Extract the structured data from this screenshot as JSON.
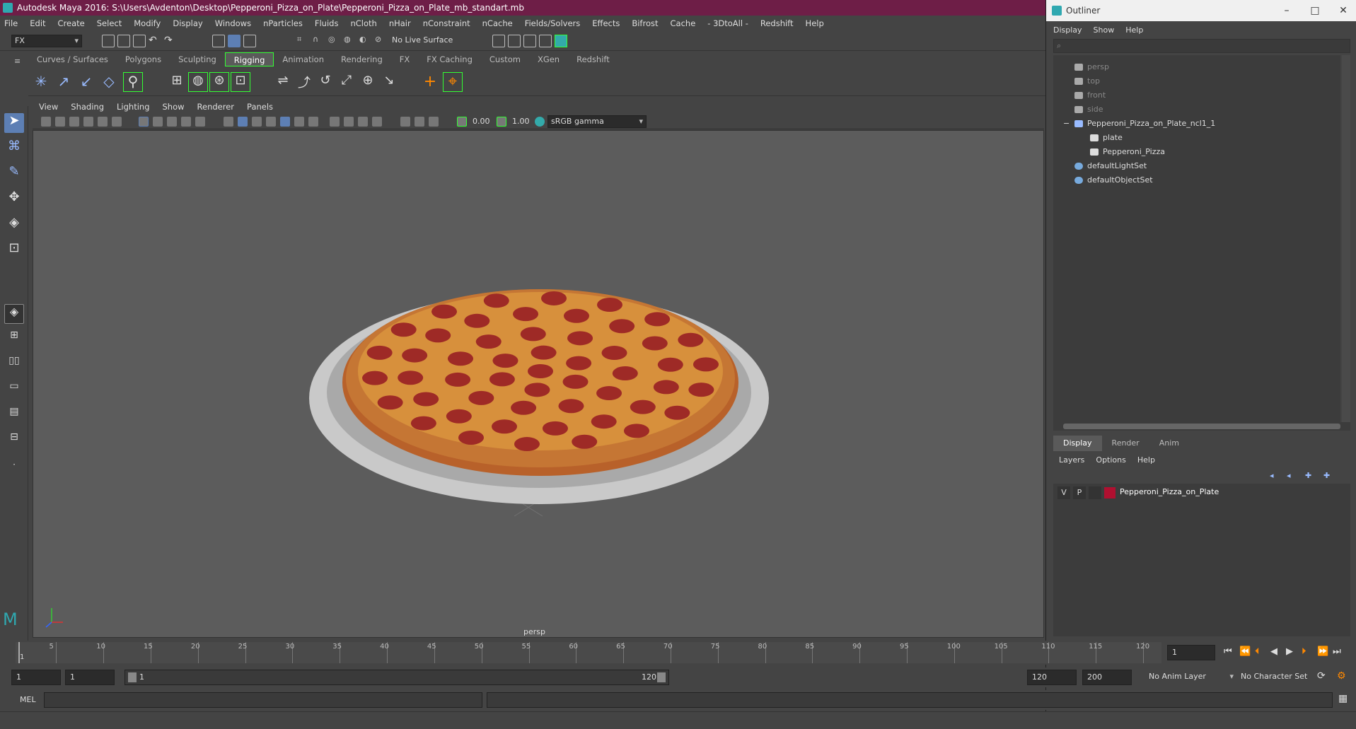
{
  "window": {
    "title": "Autodesk Maya 2016: S:\\Users\\Avdenton\\Desktop\\Pepperoni_Pizza_on_Plate\\Pepperoni_Pizza_on_Plate_mb_standart.mb"
  },
  "menubar": [
    "File",
    "Edit",
    "Create",
    "Select",
    "Modify",
    "Display",
    "Windows",
    "nParticles",
    "Fluids",
    "nCloth",
    "nHair",
    "nConstraint",
    "nCache",
    "Fields/Solvers",
    "Effects",
    "Bifrost",
    "Cache",
    "- 3DtoAll -",
    "Redshift",
    "Help"
  ],
  "statusline": {
    "mode": "FX",
    "live_surface": "No Live Surface"
  },
  "shelf": {
    "tabs": [
      "Curves / Surfaces",
      "Polygons",
      "Sculpting",
      "Rigging",
      "Animation",
      "Rendering",
      "FX",
      "FX Caching",
      "Custom",
      "XGen",
      "Redshift"
    ],
    "active_tab": "Rigging"
  },
  "viewport": {
    "menu": [
      "View",
      "Shading",
      "Lighting",
      "Show",
      "Renderer",
      "Panels"
    ],
    "exposure": "0.00",
    "gamma": "1.00",
    "colorspace": "sRGB gamma",
    "camera_label": "persp",
    "colors": {
      "bg": "#5c5c5c",
      "plate": "#c9c9c9",
      "crust": "#b8612a",
      "cheese": "#d7903c",
      "pepperoni": "#9e2a26"
    }
  },
  "outliner": {
    "title": "Outliner",
    "menu": [
      "Display",
      "Show",
      "Help"
    ],
    "nodes": [
      {
        "label": "persp",
        "icon": "camera-icon",
        "level": 0,
        "dim": true
      },
      {
        "label": "top",
        "icon": "camera-icon",
        "level": 0,
        "dim": true
      },
      {
        "label": "front",
        "icon": "camera-icon",
        "level": 0,
        "dim": true
      },
      {
        "label": "side",
        "icon": "camera-icon",
        "level": 0,
        "dim": true
      },
      {
        "label": "Pepperoni_Pizza_on_Plate_ncl1_1",
        "icon": "joint-icon",
        "level": 0,
        "dim": false,
        "expand": "−"
      },
      {
        "label": "plate",
        "icon": "mesh-icon",
        "level": 1,
        "dim": false
      },
      {
        "label": "Pepperoni_Pizza",
        "icon": "mesh-icon",
        "level": 1,
        "dim": false
      },
      {
        "label": "defaultLightSet",
        "icon": "set-icon",
        "level": 0,
        "dim": false
      },
      {
        "label": "defaultObjectSet",
        "icon": "set-icon",
        "level": 0,
        "dim": false
      }
    ]
  },
  "layers": {
    "tabs": [
      "Display",
      "Render",
      "Anim"
    ],
    "active_tab": "Display",
    "menu": [
      "Layers",
      "Options",
      "Help"
    ],
    "rows": [
      {
        "v": "V",
        "p": "P",
        "color": "#b01030",
        "name": "Pepperoni_Pizza_on_Plate"
      }
    ]
  },
  "timeline": {
    "ticks": [
      "5",
      "10",
      "15",
      "20",
      "25",
      "30",
      "35",
      "40",
      "45",
      "50",
      "55",
      "60",
      "65",
      "70",
      "75",
      "80",
      "85",
      "90",
      "95",
      "100",
      "105",
      "110",
      "115",
      "120"
    ],
    "start_label": "1",
    "current_frame": "1"
  },
  "range": {
    "start": "1",
    "anim_start": "1",
    "slider_start": "1",
    "slider_end": "120",
    "end": "120",
    "anim_end": "200",
    "anim_layer": "No Anim Layer",
    "char_set": "No Character Set"
  },
  "cmdline": {
    "label": "MEL"
  }
}
